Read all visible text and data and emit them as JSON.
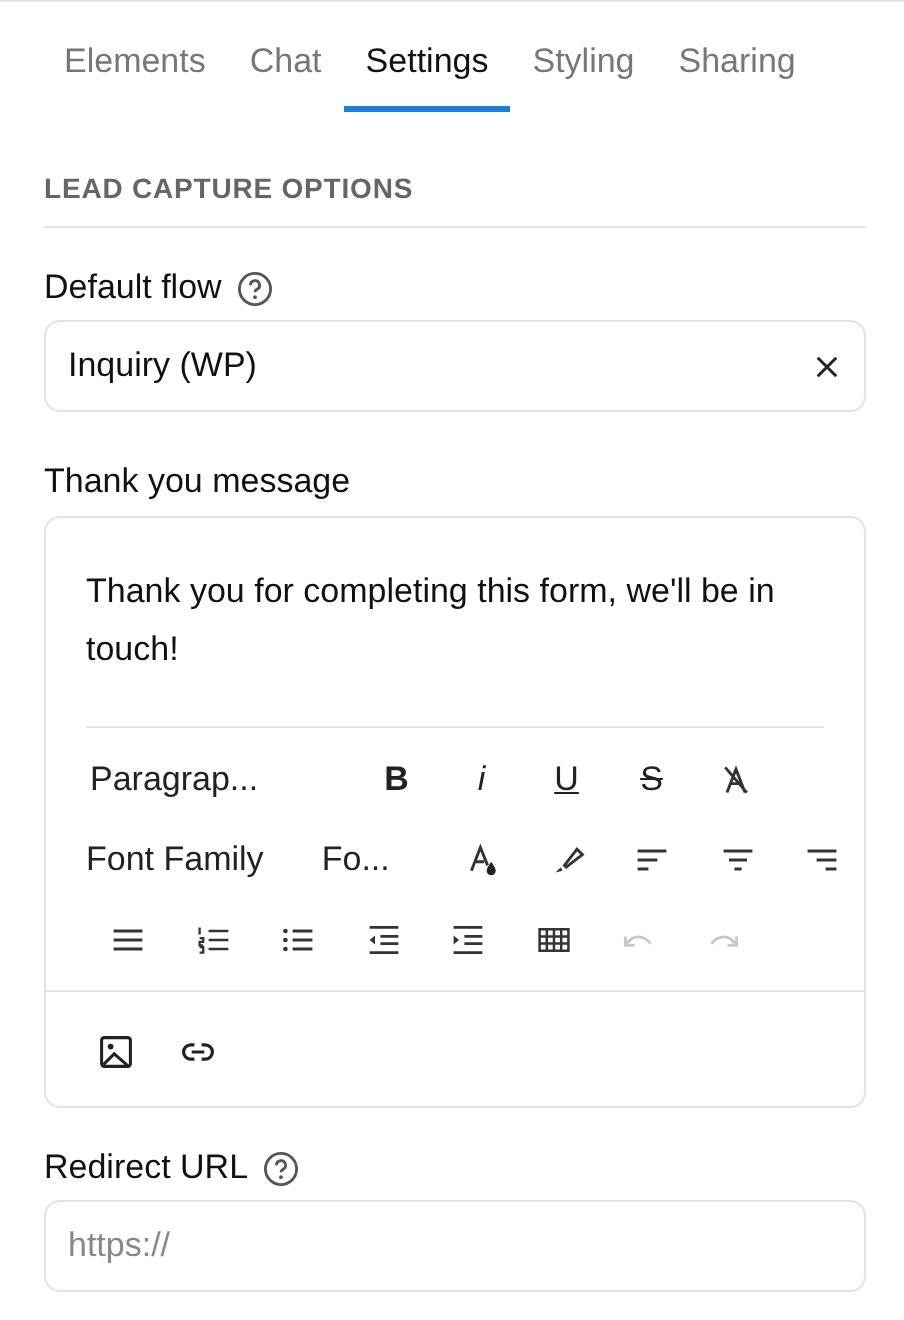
{
  "tabs": [
    {
      "label": "Elements",
      "selected": false
    },
    {
      "label": "Chat",
      "selected": false
    },
    {
      "label": "Settings",
      "selected": true
    },
    {
      "label": "Styling",
      "selected": false
    },
    {
      "label": "Sharing",
      "selected": false
    }
  ],
  "section_title": "LEAD CAPTURE OPTIONS",
  "default_flow": {
    "label": "Default flow",
    "value": "Inquiry (WP)"
  },
  "thank_you": {
    "label": "Thank you message",
    "text": "Thank you for completing this form, we'll be in touch!",
    "toolbar": {
      "block_format": "Paragrap...",
      "bold": "B",
      "italic": "i",
      "underline": "U",
      "strikethrough": "S",
      "font_family": "Font Family",
      "font_size": "Fo...",
      "undo": {
        "disabled": true
      },
      "redo": {
        "disabled": true
      }
    }
  },
  "redirect_url": {
    "label": "Redirect URL",
    "placeholder": "https://"
  }
}
